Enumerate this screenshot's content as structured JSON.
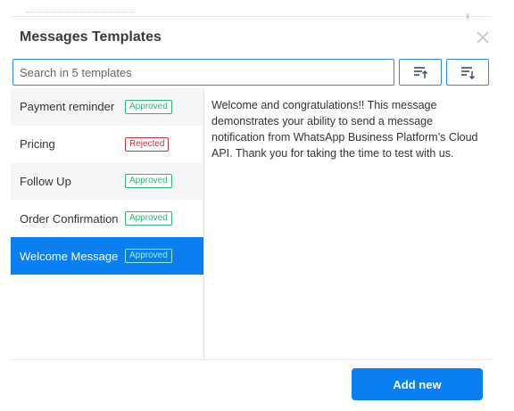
{
  "dialog": {
    "title": "Messages Templates",
    "close_icon": "close-icon"
  },
  "search": {
    "placeholder": "Search in 5 templates",
    "value": ""
  },
  "sort": {
    "asc_icon": "sort-ascending-icon",
    "desc_icon": "sort-descending-icon"
  },
  "templates": [
    {
      "name": "Payment reminder",
      "status": "Approved"
    },
    {
      "name": "Pricing",
      "status": "Rejected"
    },
    {
      "name": "Follow Up",
      "status": "Approved"
    },
    {
      "name": "Order Confirmation",
      "status": "Approved"
    },
    {
      "name": "Welcome Message",
      "status": "Approved"
    }
  ],
  "selected_index": 4,
  "preview": {
    "text": "Welcome and congratulations!! This message demonstrates your ability to send a message notification from WhatsApp Business Platform’s Cloud API. Thank you for taking the time to test with us."
  },
  "footer": {
    "add_label": "Add new"
  },
  "colors": {
    "accent": "#0a7ff2",
    "approved": "#2bb673",
    "rejected": "#c8323c"
  }
}
